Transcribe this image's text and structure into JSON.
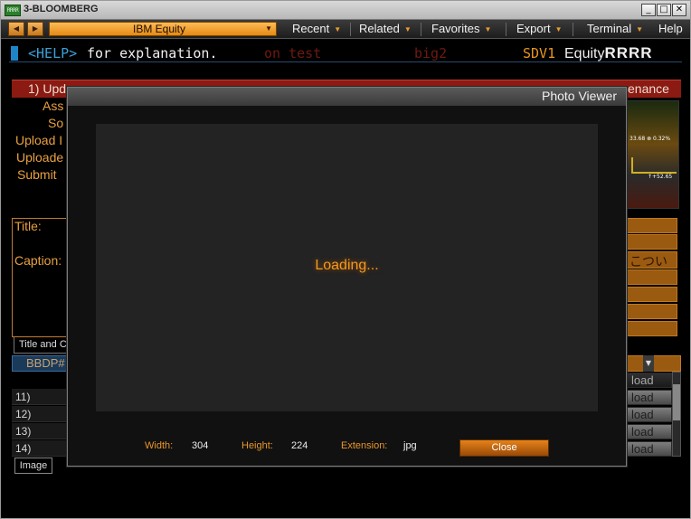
{
  "window": {
    "logo_text": "RRRR",
    "title": "3-BLOOMBERG",
    "minimize_glyph": "_",
    "maximize_glyph": "□",
    "close_glyph": "✕"
  },
  "menubar": {
    "security": "IBM Equity",
    "items": [
      "Recent",
      "Related",
      "Favorites",
      "Export",
      "Terminal"
    ],
    "help": "Help"
  },
  "command": {
    "help_key": "<HELP>",
    "help_text": "for explanation.",
    "ghost_1": "on test",
    "ghost_2": "big2",
    "code": "SDV1",
    "equity_prefix": "Equity",
    "equity_suffix": "RRRR"
  },
  "background": {
    "tabs": [
      "1) Upd",
      "enance"
    ],
    "labels": [
      "Ass",
      "So",
      "Upload I",
      "Uploade",
      "Submit"
    ],
    "title_label": "Title:",
    "caption_label": "Caption:",
    "caption_value": "こつい",
    "tabstrip_label": "Title and C",
    "table_header": "BBDP#",
    "rows": [
      "11)",
      "12)",
      "13)",
      "14)"
    ],
    "upload_label": "load",
    "bottom_tab": "Image",
    "thumb_text_1": "33.68 ⊗ 0.32%",
    "thumb_text_2": "↑+52.65"
  },
  "photo_viewer": {
    "title": "Photo Viewer",
    "loading": "Loading...",
    "width_label": "Width:",
    "width_value": "304",
    "height_label": "Height:",
    "height_value": "224",
    "extension_label": "Extension:",
    "extension_value": "jpg",
    "close_label": "Close"
  }
}
